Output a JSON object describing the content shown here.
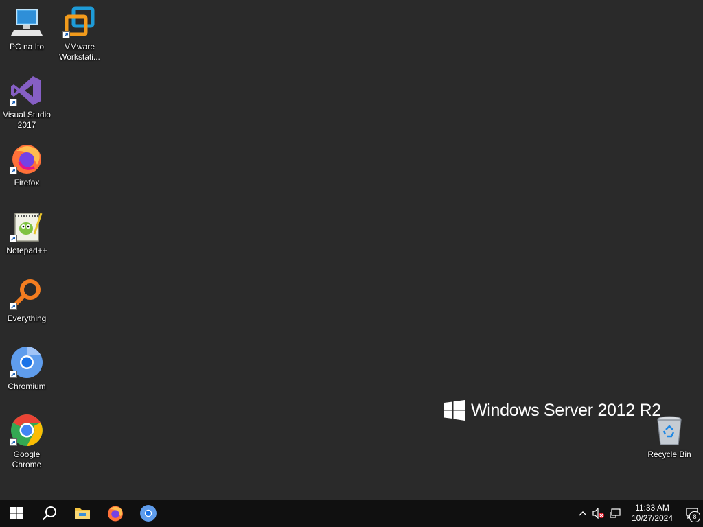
{
  "desktop": {
    "icons": [
      {
        "label": "PC na Ito"
      },
      {
        "label": "VMware Workstati..."
      },
      {
        "label": "Visual Studio 2017"
      },
      {
        "label": "Firefox"
      },
      {
        "label": "Notepad++"
      },
      {
        "label": "Everything"
      },
      {
        "label": "Chromium"
      },
      {
        "label": "Google Chrome"
      },
      {
        "label": "Recycle Bin"
      }
    ],
    "watermark": "Windows Server 2012 R2",
    "background_color": "#2a2a2a"
  },
  "taskbar": {
    "background_color": "#101010",
    "pinned": [
      "start-icon",
      "search-icon",
      "file-explorer-icon",
      "firefox-icon",
      "chromium-icon"
    ],
    "clock": {
      "time": "11:33 AM",
      "date": "10/27/2024"
    },
    "notification_count": "8"
  }
}
